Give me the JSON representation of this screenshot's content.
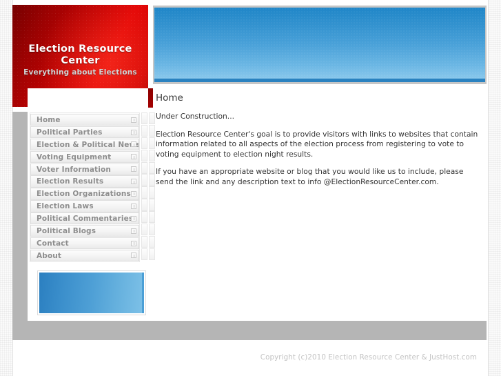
{
  "site": {
    "logo_title": "Election Resource Center",
    "logo_tagline": "Everything about Elections",
    "banner_alt": "blue-gradient-banner"
  },
  "nav": {
    "items": [
      {
        "label": "Home",
        "expand_icon": "expand-box-icon"
      },
      {
        "label": "Political Parties",
        "expand_icon": "expand-box-icon"
      },
      {
        "label": "Election & Political News",
        "expand_icon": "expand-box-icon"
      },
      {
        "label": "Voting Equipment",
        "expand_icon": "expand-box-icon"
      },
      {
        "label": "Voter Information",
        "expand_icon": "expand-box-icon"
      },
      {
        "label": "Election Results",
        "expand_icon": "expand-box-icon"
      },
      {
        "label": "Election Organizations",
        "expand_icon": "expand-box-icon"
      },
      {
        "label": "Election Laws",
        "expand_icon": "expand-box-icon"
      },
      {
        "label": "Political Commentaries",
        "expand_icon": "expand-box-icon"
      },
      {
        "label": "Political Blogs",
        "expand_icon": "expand-box-icon"
      },
      {
        "label": "Contact",
        "expand_icon": "expand-box-icon"
      },
      {
        "label": "About",
        "expand_icon": "expand-box-icon"
      }
    ]
  },
  "content": {
    "title": "Home",
    "paragraphs": [
      "Under Construction...",
      "Election Resource Center's goal is to provide visitors with links to websites that contain information related to all aspects of the election process from registering to vote to voting equipment to election night results.",
      "If you have an appropriate website or blog that you would like us to include, please send the link and any description text to info @ElectionResourceCenter.com."
    ]
  },
  "footer": {
    "copyright": "Copyright (c)2010 Election Resource Center & JustHost.com"
  },
  "colors": {
    "logo_red_dark": "#760000",
    "logo_red_bright": "#e30606",
    "banner_blue_top": "#1f86c8",
    "banner_blue_bottom": "#8ac8ec",
    "sidebar_gray": "#b5b5b5",
    "footer_gray": "#b5b5b5",
    "nav_text": "#8d8d8d",
    "body_text": "#333333",
    "footer_text": "#c3c3c3"
  }
}
